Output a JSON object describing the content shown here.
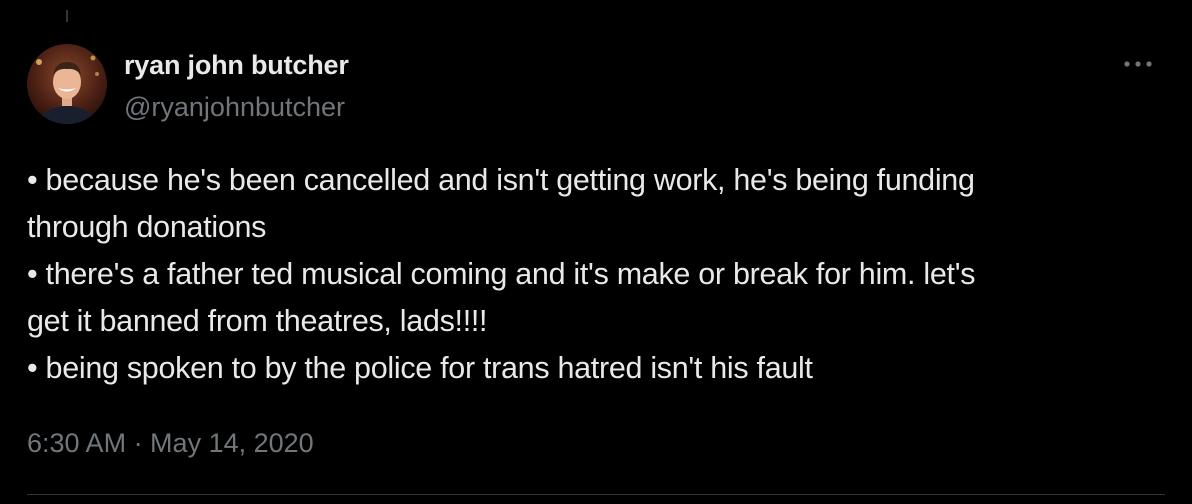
{
  "tweet": {
    "author": {
      "display_name": "ryan john butcher",
      "handle": "@ryanjohnbutcher",
      "avatar_icon": "user-avatar"
    },
    "more_icon": "more-horizontal-icon",
    "lines": [
      "• because he's been cancelled and isn't getting work, he's being funding",
      "through donations",
      "• there's a father ted musical coming and it's make or break for him. let's",
      "get it banned from theatres, lads!!!!",
      "• being spoken to by the police for trans hatred isn't his fault"
    ],
    "timestamp": "6:30 AM · May 14, 2020"
  },
  "colors": {
    "background": "#000000",
    "primary_text": "#e7e9ea",
    "secondary_text": "#71767b",
    "divider": "#2f3336"
  }
}
